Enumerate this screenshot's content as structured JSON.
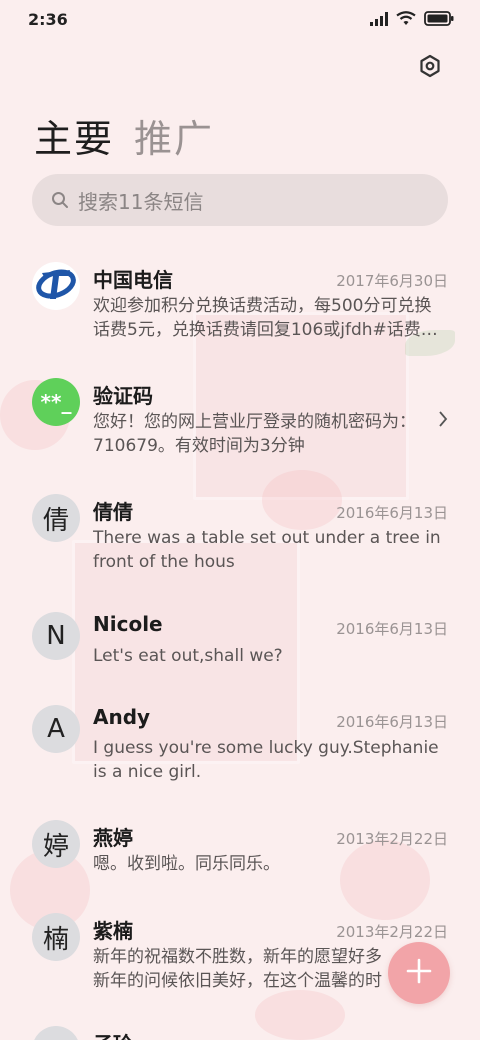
{
  "status_bar": {
    "time": "2:36"
  },
  "tabs": [
    {
      "label": "主要"
    },
    {
      "label": "推广"
    }
  ],
  "search": {
    "placeholder": "搜索11条短信"
  },
  "conversations": [
    {
      "avatar_text": "",
      "avatar_icon": "telecom-logo-icon",
      "name": "中国电信",
      "date": "2017年6月30日",
      "preview_lines": [
        "欢迎参加积分兑换话费活动，每500分可兑换",
        "话费5元，兑换话费请回复106或jfdh#话费…"
      ]
    },
    {
      "avatar_text": "**_",
      "name": "验证码",
      "date": "",
      "preview_lines": [
        "您好！您的网上营业厅登录的随机密码为：",
        "710679。有效时间为3分钟"
      ],
      "avatar_color": "#5fd05a"
    },
    {
      "avatar_text": "倩",
      "name": "倩倩",
      "date": "2016年6月13日",
      "preview_lines": [
        "There was a table set out under a tree in",
        "front of the hous"
      ]
    },
    {
      "avatar_text": "N",
      "name": "Nicole",
      "date": "2016年6月13日",
      "preview_lines": [
        "Let's eat out,shall we?"
      ]
    },
    {
      "avatar_text": "A",
      "name": "Andy",
      "date": "2016年6月13日",
      "preview_lines": [
        "I guess you're some lucky guy.Stephanie",
        "is a nice girl."
      ]
    },
    {
      "avatar_text": "婷",
      "name": "燕婷",
      "date": "2013年2月22日",
      "preview_lines": [
        "嗯。收到啦。同乐同乐。"
      ]
    },
    {
      "avatar_text": "楠",
      "name": "紫楠",
      "date": "2013年2月22日",
      "preview_lines": [
        "新年的祝福数不胜数，新年的愿望好多",
        "新年的问候依旧美好，在这个温馨的时"
      ]
    },
    {
      "avatar_text": "",
      "name": "子玲",
      "date": "",
      "preview_lines": []
    }
  ],
  "colors": {
    "background": "#fbeeee",
    "fab": "#f0969b",
    "verify_avatar": "#5fd05a",
    "telecom_blue": "#1f56a8"
  }
}
